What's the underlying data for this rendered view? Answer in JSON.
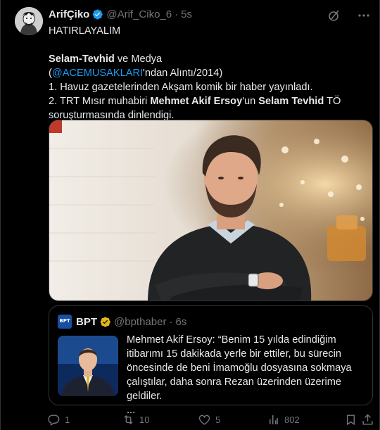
{
  "author": {
    "name": "ArifÇiko",
    "handle": "@Arif_Ciko_6",
    "time": "5s"
  },
  "tweet": {
    "line1": "HATIRLAYALIM",
    "title_bold": "Selam-Tevhid",
    "title_rest": " ve Medya",
    "paren_open": "(",
    "mention": "@ACEMUSAKLARI",
    "paren_rest": "'ndan Alıntı/2014)",
    "item1": "1. Havuz gazetelerinden Akşam komik bir haber yayınladı.",
    "item2_a": "2. TRT Mısır muhabiri ",
    "item2_b": "Mehmet Akif Ersoy",
    "item2_c": "'un ",
    "item2_d": "Selam Tevhid",
    "item2_e": " TÖ",
    "item2_f": "soruşturmasında dinlendigi."
  },
  "quote": {
    "logo_text": "BPT",
    "name": "BPT",
    "handle": "@bpthaber",
    "time": "6s",
    "text": "Mehmet Akif Ersoy: “Benim 15 yılda edindiğim itibarımı 15 dakikada yerle bir ettiler, bu sürecin öncesinde de beni İmamoğlu dosyasına sokmaya çalıştılar, daha sonra Rezan üzerinden üzerime geldiler.",
    "ellipsis": "..."
  },
  "actions": {
    "replies": "1",
    "retweets": "10",
    "likes": "5",
    "views": "802"
  },
  "colors": {
    "background": "#000000",
    "text": "#e7e9ea",
    "muted": "#71767b",
    "link": "#1d9bf0",
    "border": "#2f3336",
    "verified_blue": "#1d9bf0",
    "verified_gold": "#e2b719"
  },
  "icons": [
    "verified-badge-icon",
    "grok-icon",
    "more-icon",
    "reply-icon",
    "retweet-icon",
    "like-icon",
    "views-icon",
    "bookmark-icon",
    "share-icon"
  ]
}
